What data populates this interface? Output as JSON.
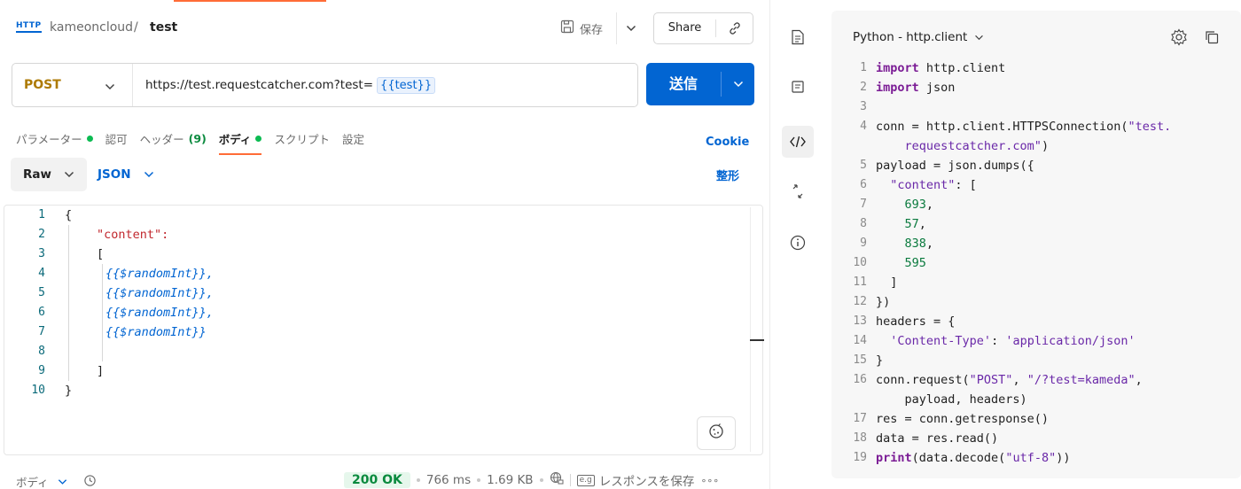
{
  "header": {
    "http_badge": "HTTP",
    "workspace": "kameoncloud",
    "separator": "/",
    "request_name": "test",
    "save_label": "保存",
    "share_label": "Share"
  },
  "request": {
    "method": "POST",
    "url_prefix": "https://test.requestcatcher.com?test=",
    "url_variable": "{{test}}",
    "send_label": "送信"
  },
  "tabs": [
    {
      "label": "パラメーター",
      "dot": true
    },
    {
      "label": "認可"
    },
    {
      "label": "ヘッダー",
      "count": "(9)"
    },
    {
      "label": "ボディ",
      "dot": true,
      "active": true
    },
    {
      "label": "スクリプト"
    },
    {
      "label": "設定"
    }
  ],
  "cookie_label": "Cookie",
  "body_mode": {
    "raw_label": "Raw",
    "format_label": "JSON",
    "beautify_label": "整形"
  },
  "editor": {
    "line_numbers": [
      "1",
      "2",
      "3",
      "4",
      "5",
      "6",
      "7",
      "8",
      "9",
      "10"
    ],
    "lines": [
      {
        "text": "{"
      },
      {
        "text": "\"content\":",
        "type": "key"
      },
      {
        "text": "["
      },
      {
        "text": "{{$randomInt}},",
        "type": "var"
      },
      {
        "text": "{{$randomInt}},",
        "type": "var"
      },
      {
        "text": "{{$randomInt}},",
        "type": "var"
      },
      {
        "text": "{{$randomInt}}",
        "type": "var"
      },
      {
        "text": ""
      },
      {
        "text": "]"
      },
      {
        "text": "}"
      }
    ]
  },
  "status": {
    "body_label": "ボディ",
    "code": "200 OK",
    "time": "766 ms",
    "size": "1.69 KB",
    "save_response_label": "レスポンスを保存",
    "more": "∘∘∘"
  },
  "snippet": {
    "language": "Python - http.client",
    "line_numbers": [
      "1",
      "2",
      "3",
      "4",
      "",
      "5",
      "6",
      "7",
      "8",
      "9",
      "10",
      "11",
      "12",
      "13",
      "14",
      "15",
      "16",
      "",
      "17",
      "18",
      "19"
    ],
    "lines": [
      "import http.client",
      "import json",
      "",
      "conn = http.client.HTTPSConnection(\"test.",
      "    requestcatcher.com\")",
      "payload = json.dumps({",
      "  \"content\": [",
      "    693,",
      "    57,",
      "    838,",
      "    595",
      "  ]",
      "})",
      "headers = {",
      "  'Content-Type': 'application/json'",
      "}",
      "conn.request(\"POST\", \"/?test=kameda\",",
      "    payload, headers)",
      "res = conn.getresponse()",
      "data = res.read()",
      "print(data.decode(\"utf-8\"))"
    ]
  },
  "icons": [
    "http-icon",
    "save-icon",
    "chevron-down-icon",
    "link-icon",
    "document-icon",
    "comment-icon",
    "code-icon",
    "related-icon",
    "info-icon",
    "settings-icon",
    "copy-icon",
    "history-icon",
    "globe-lock-icon",
    "cookie-icon"
  ],
  "colors": {
    "accent": "#ff6c37",
    "primary": "#0265d2",
    "method": "#ad7a03",
    "success": "#0cbb52"
  }
}
